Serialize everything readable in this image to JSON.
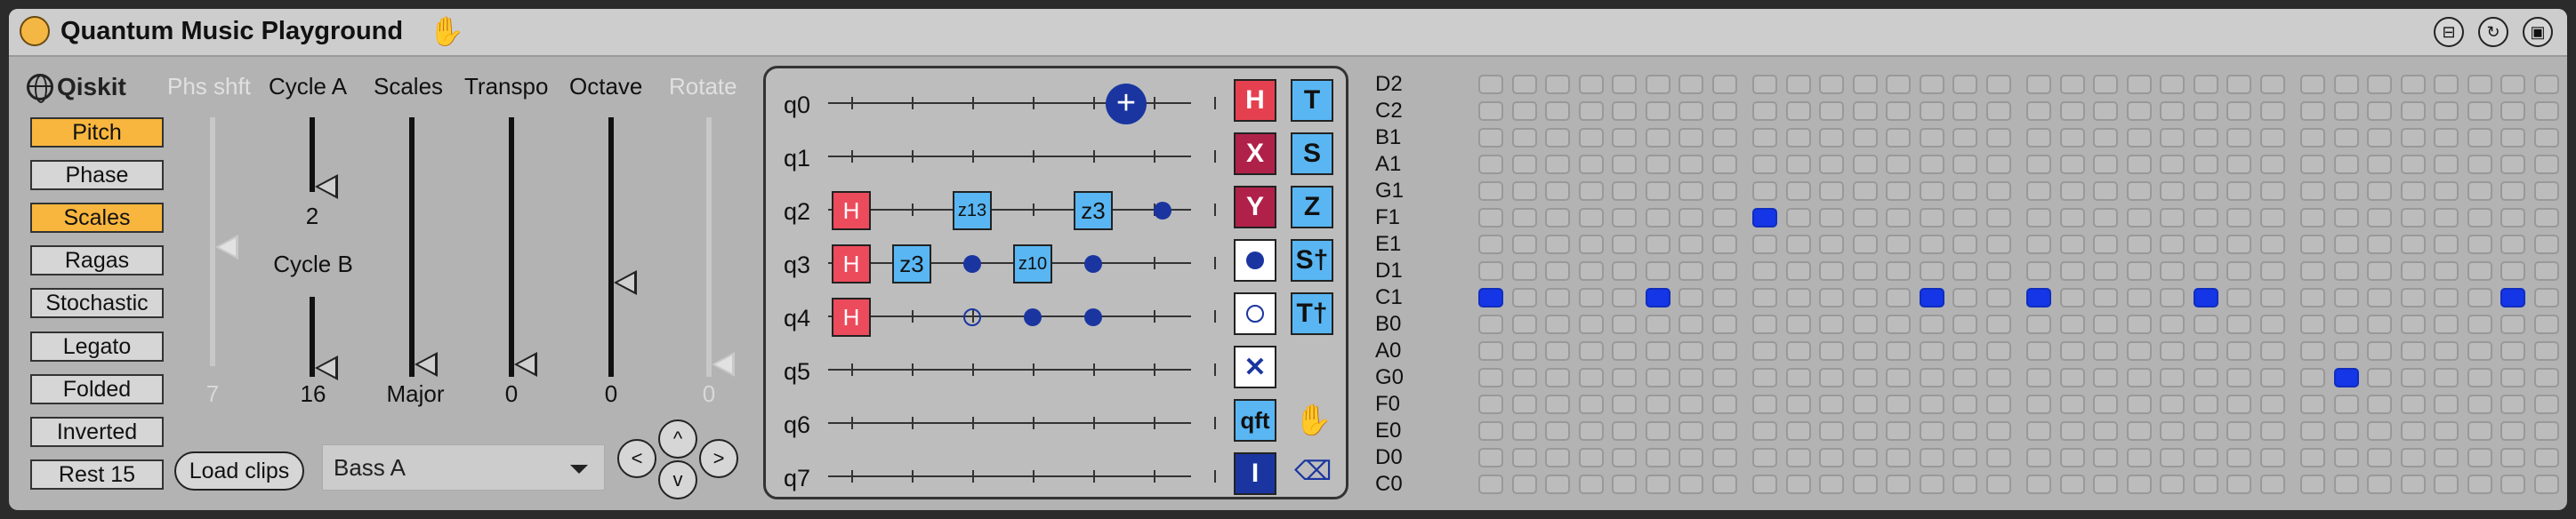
{
  "title": "Quantum Music Playground",
  "logo": "Qiskit",
  "left_buttons": [
    {
      "label": "Pitch",
      "on": true
    },
    {
      "label": "Phase",
      "on": false
    },
    {
      "label": "Scales",
      "on": true
    },
    {
      "label": "Ragas",
      "on": false
    },
    {
      "label": "Stochastic",
      "on": false
    },
    {
      "label": "Legato",
      "on": false
    },
    {
      "label": "Folded",
      "on": false
    },
    {
      "label": "Inverted",
      "on": false
    },
    {
      "label": "Rest 15",
      "on": false
    }
  ],
  "controls": {
    "phs_shft": {
      "label": "Phs shft",
      "value": "7"
    },
    "cycle_a": {
      "label": "Cycle A",
      "value": "2"
    },
    "cycle_b": {
      "label": "Cycle B",
      "value": "16"
    },
    "scales": {
      "label": "Scales",
      "value": "Major"
    },
    "transpo": {
      "label": "Transpo",
      "value": "0"
    },
    "octave": {
      "label": "Octave",
      "value": "0"
    },
    "rotate": {
      "label": "Rotate",
      "value": "0"
    }
  },
  "load_clips": "Load clips",
  "clip_select": "Bass A",
  "nav": {
    "left": "<",
    "up": "^",
    "right": ">",
    "down": "v"
  },
  "qubits": [
    "q0",
    "q1",
    "q2",
    "q3",
    "q4",
    "q5",
    "q6",
    "q7"
  ],
  "gates": {
    "q2_h": "H",
    "q2_z13": "z13",
    "q2_z3": "z3",
    "q3_h": "H",
    "q3_z3": "z3",
    "q3_z10": "z10",
    "q4_h": "H"
  },
  "palette": {
    "h": "H",
    "t": "T",
    "x": "X",
    "s": "S",
    "y": "Y",
    "z": "Z",
    "s_dag": "S†",
    "t_dag": "T†",
    "qft": "qft",
    "i": "I"
  },
  "notes": [
    "D2",
    "C2",
    "B1",
    "A1",
    "G1",
    "F1",
    "E1",
    "D1",
    "C1",
    "B0",
    "A0",
    "G0",
    "F0",
    "E0",
    "D0",
    "C0"
  ],
  "grid": {
    "columns": 32,
    "active": [
      [
        8,
        0
      ],
      [
        8,
        5
      ],
      [
        5,
        8
      ],
      [
        8,
        13
      ],
      [
        8,
        16
      ],
      [
        8,
        21
      ],
      [
        11,
        25
      ],
      [
        8,
        30
      ]
    ]
  },
  "colors": {
    "accent": "#f8b63e",
    "note_on": "#1436e6",
    "h_gate": "#ec4b5b",
    "phase_gate": "#59b6f2",
    "control": "#1a35a0"
  }
}
